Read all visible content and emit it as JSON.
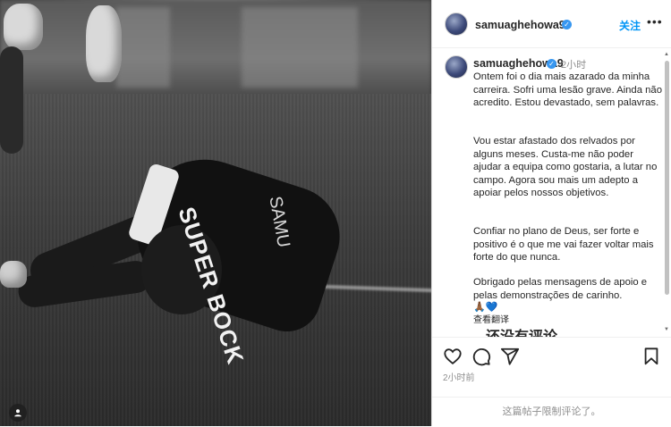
{
  "post": {
    "author": "samuaghehowa9",
    "follow_label": "关注",
    "more_label": "•••",
    "caption_time": "2小时",
    "caption_paragraphs": [
      "Ontem foi o dia mais azarado da minha carreira. Sofri uma lesão grave. Ainda não acredito. Estou devastado, sem palavras.",
      "Vou estar afastado dos relvados por alguns meses. Custa-me não poder ajudar a equipa como gostaria, a lutar no campo. Agora sou mais um adepto a apoiar pelos nossos objetivos.",
      "Confiar no plano de Deus, ser forte e positivo é o que me vai fazer voltar mais forte do que nunca.",
      "Obrigado pelas mensagens de apoio e pelas demonstrações de carinho."
    ],
    "caption_emojis": "🙏🏾💙",
    "see_translation": "查看翻译",
    "cut_off_text": "还没有评论",
    "posted_time": "2小时前",
    "comments_disabled": "这篇帖子限制评论了。"
  },
  "photo": {
    "jersey_sponsor": "SUPER BOCK",
    "jersey_name": "SAMU"
  },
  "icons": {
    "like": "heart-icon",
    "comment": "comment-icon",
    "share": "paper-plane-icon",
    "save": "bookmark-icon",
    "verified": "verified-badge-icon",
    "user_tag": "user-tag-icon"
  },
  "colors": {
    "accent": "#0095f6",
    "verified": "#3897f0",
    "muted": "#8e8e8e",
    "text": "#262626"
  }
}
